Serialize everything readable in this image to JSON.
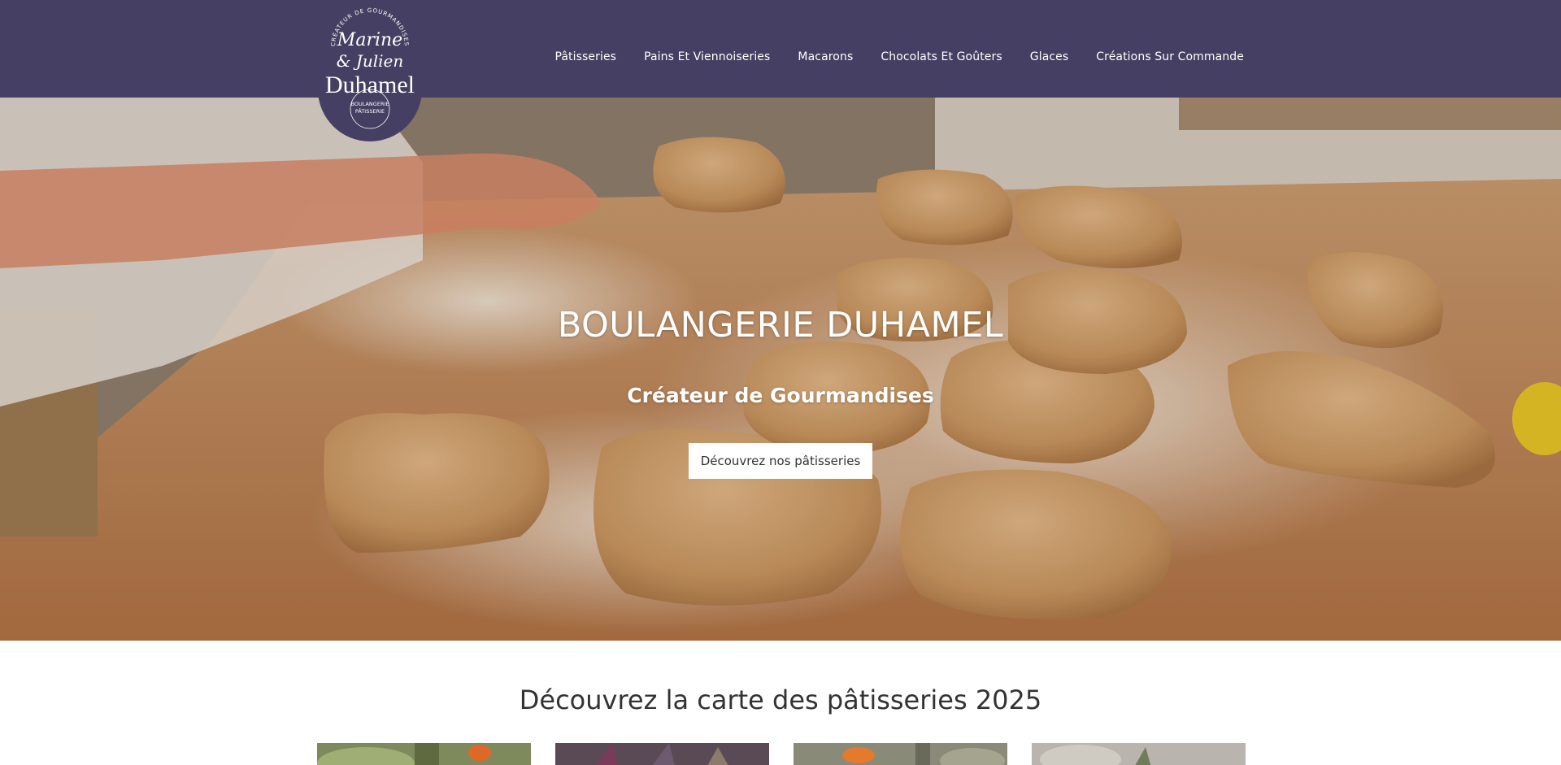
{
  "logo": {
    "arc_text": "CRÉATEUR DE GOURMANDISES",
    "script_line1": "Marine",
    "script_line2": "& Julien",
    "brand": "Duhamel",
    "sub_line1": "BOULANGERIE",
    "sub_line2": "PÂTISSERIE"
  },
  "nav": {
    "items": [
      {
        "label": "Pâtisseries"
      },
      {
        "label": "Pains Et Viennoiseries"
      },
      {
        "label": "Macarons"
      },
      {
        "label": "Chocolats Et Goûters"
      },
      {
        "label": "Glaces"
      },
      {
        "label": "Créations Sur Commande"
      }
    ]
  },
  "hero": {
    "title": "BOULANGERIE DUHAMEL",
    "subtitle": "Créateur de Gourmandises",
    "button_label": "Découvrez nos pâtisseries"
  },
  "section": {
    "title": "Découvrez la carte des pâtisseries 2025"
  },
  "colors": {
    "header_bg": "#453f63",
    "text": "#333333"
  }
}
